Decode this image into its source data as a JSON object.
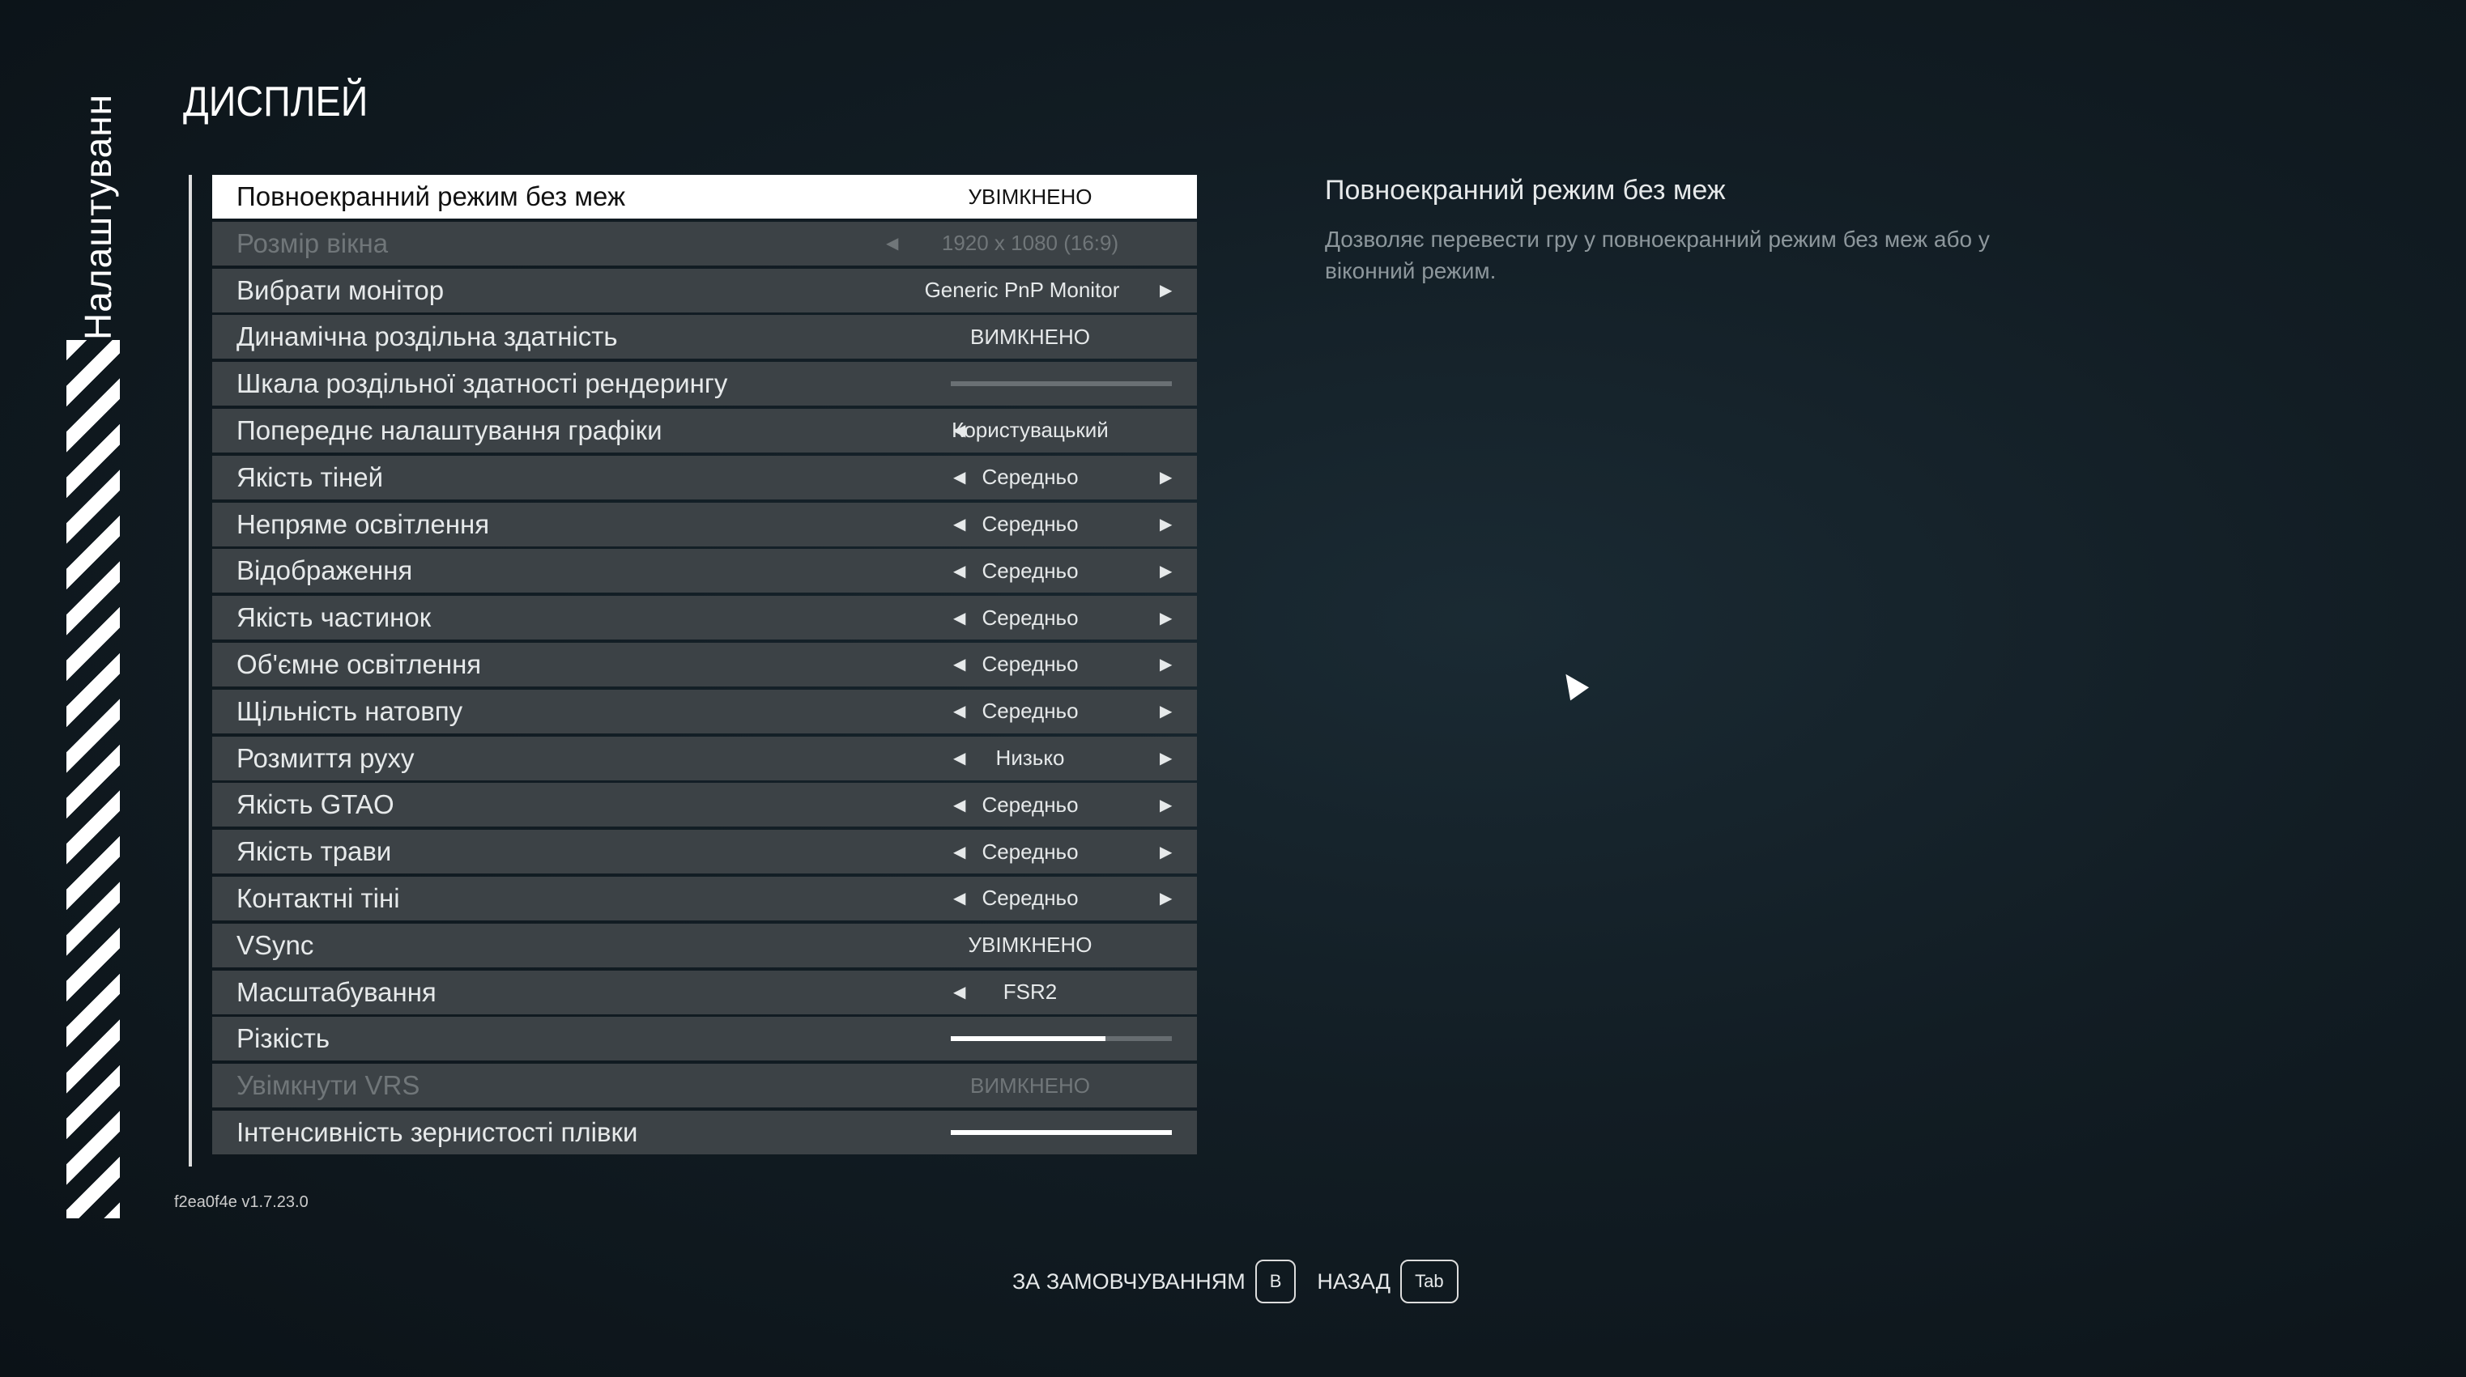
{
  "sidebar_title": "Налаштуванн",
  "page_title": "ДИСПЛЕЙ",
  "settings": [
    {
      "label": "Повноекранний режим без меж",
      "value": "УВІМКНЕНО",
      "type": "toggle",
      "selected": true
    },
    {
      "label": "Розмір вікна",
      "value": "1920 x 1080 (16:9)",
      "type": "select-left",
      "disabled": true
    },
    {
      "label": "Вибрати монітор",
      "value": "Generic PnP Monitor",
      "type": "select-right"
    },
    {
      "label": "Динамічна роздільна здатність",
      "value": "ВИМКНЕНО",
      "type": "toggle"
    },
    {
      "label": "Шкала роздільної здатності рендерингу",
      "type": "slider",
      "fill": 0,
      "dim": true
    },
    {
      "label": "Попереднє налаштування графіки",
      "value": "Користувацький",
      "type": "select-left"
    },
    {
      "label": "Якість тіней",
      "value": "Середньо",
      "type": "select"
    },
    {
      "label": "Непряме освітлення",
      "value": "Середньо",
      "type": "select"
    },
    {
      "label": "Відображення",
      "value": "Середньо",
      "type": "select"
    },
    {
      "label": "Якість частинок",
      "value": "Середньо",
      "type": "select"
    },
    {
      "label": "Об'ємне освітлення",
      "value": "Середньо",
      "type": "select"
    },
    {
      "label": "Щільність натовпу",
      "value": "Середньо",
      "type": "select"
    },
    {
      "label": "Розмиття руху",
      "value": "Низько",
      "type": "select"
    },
    {
      "label": "Якість GTAO",
      "value": "Середньо",
      "type": "select"
    },
    {
      "label": "Якість трави",
      "value": "Середньо",
      "type": "select"
    },
    {
      "label": "Контактні тіні",
      "value": "Середньо",
      "type": "select"
    },
    {
      "label": "VSync",
      "value": "УВІМКНЕНО",
      "type": "toggle"
    },
    {
      "label": "Масштабування",
      "value": "FSR2",
      "type": "select-left"
    },
    {
      "label": "Різкість",
      "type": "slider",
      "fill": 0.7
    },
    {
      "label": "Увімкнути VRS",
      "value": "ВИМКНЕНО",
      "type": "toggle",
      "disabled": true
    },
    {
      "label": "Інтенсивність зернистості плівки",
      "type": "slider",
      "fill": 1.0
    }
  ],
  "description": {
    "title": "Повноекранний режим без меж",
    "body": "Дозволяє перевести гру у повноекранний режим без меж або у віконний режим."
  },
  "version": "f2ea0f4e v1.7.23.0",
  "footer": {
    "default_label": "ЗА ЗАМОВЧУВАННЯМ",
    "default_key": "B",
    "back_label": "НАЗАД",
    "back_key": "Tab"
  }
}
